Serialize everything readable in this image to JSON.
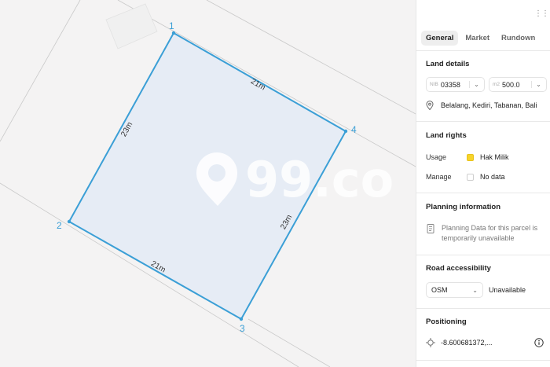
{
  "map": {
    "vertices": [
      {
        "label": "1"
      },
      {
        "label": "2"
      },
      {
        "label": "3"
      },
      {
        "label": "4"
      }
    ],
    "edges": [
      {
        "label": "21m"
      },
      {
        "label": "23m"
      },
      {
        "label": "21m"
      },
      {
        "label": "23m"
      }
    ],
    "watermark": "99.co",
    "colors": {
      "outline": "#3b9fd6",
      "fill": "#e6ecf5"
    }
  },
  "panel": {
    "more_icon": "⋮⋮",
    "tabs": [
      {
        "label": "General",
        "active": true
      },
      {
        "label": "Market",
        "active": false
      },
      {
        "label": "Rundown",
        "active": false
      }
    ],
    "land_details": {
      "title": "Land details",
      "nib_prefix": "NIB",
      "nib_value": "03358",
      "area_prefix": "m2",
      "area_value": "500.0",
      "location": "Belalang, Kediri, Tabanan, Bali"
    },
    "land_rights": {
      "title": "Land rights",
      "usage_label": "Usage",
      "usage_value": "Hak Milik",
      "usage_color": "#f7d42b",
      "manage_label": "Manage",
      "manage_value": "No data"
    },
    "planning": {
      "title": "Planning information",
      "message": "Planning Data for this parcel is temporarily unavailable"
    },
    "road": {
      "title": "Road accessibility",
      "select_value": "OSM",
      "status": "Unavailable"
    },
    "positioning": {
      "title": "Positioning",
      "coordinates": "-8.600681372,..."
    }
  }
}
